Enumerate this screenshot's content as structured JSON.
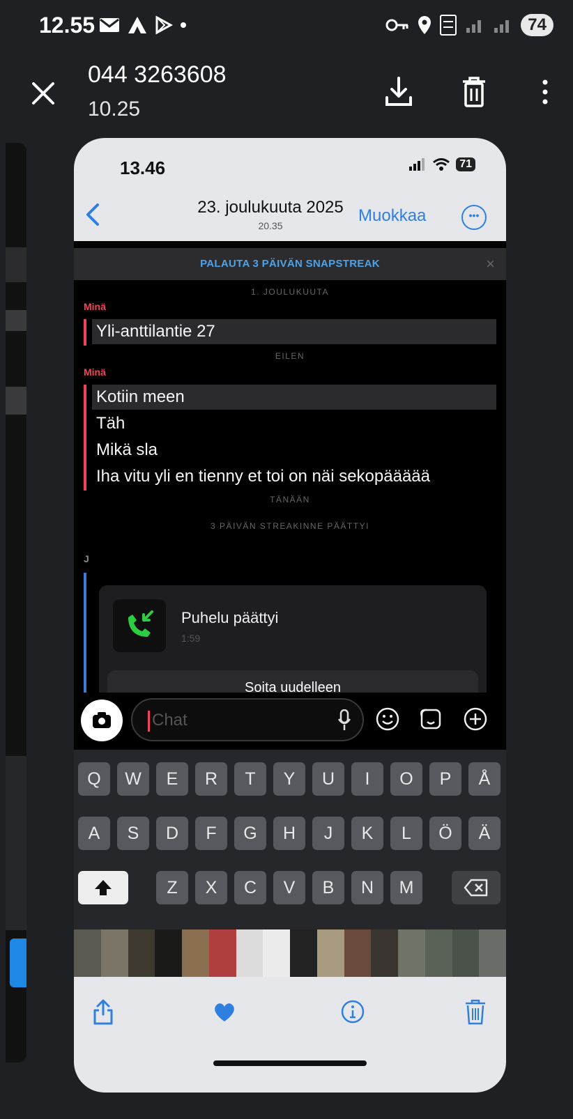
{
  "android_status": {
    "time": "12.55",
    "battery": "74"
  },
  "viewer": {
    "contact": "044 3263608",
    "time": "10.25"
  },
  "ios_status": {
    "time": "13.46",
    "battery": "71"
  },
  "ios_header": {
    "date": "23. joulukuuta 2025",
    "time": "20.35",
    "edit": "Muokkaa"
  },
  "snap": {
    "banner": "PALAUTA 3 PÄIVÄN SNAPSTREAK",
    "date1": "1. JOULUKUUTA",
    "sender_me": "Minä",
    "msg1": "Yli-anttilantie 27",
    "date2": "EILEN",
    "sender_me2": "Minä",
    "messages": [
      "Kotiin meen",
      "Täh",
      "Mikä sla",
      "Iha vitu yli en tienny et toi on näi sekopäääää"
    ],
    "date3": "TÄNÄÄN",
    "streak_ended": "3 PÄIVÄN STREAKINNE PÄÄTTYI",
    "sender_j": "J",
    "call_title": "Puhelu päättyi",
    "call_duration": "1:59",
    "call_again": "Soita uudelleen",
    "chat_placeholder": "Chat"
  },
  "keyboard": {
    "row1": [
      "Q",
      "W",
      "E",
      "R",
      "T",
      "Y",
      "U",
      "I",
      "O",
      "P",
      "Å"
    ],
    "row2": [
      "A",
      "S",
      "D",
      "F",
      "G",
      "H",
      "J",
      "K",
      "L",
      "Ö",
      "Ä"
    ],
    "row3": [
      "Z",
      "X",
      "C",
      "V",
      "B",
      "N",
      "M"
    ]
  },
  "colors": {
    "snap_red": "#f0445a",
    "ios_blue": "#2f7fe0",
    "call_green": "#2ecc40"
  }
}
